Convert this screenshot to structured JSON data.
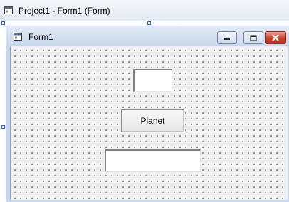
{
  "designer": {
    "title": "Project1 - Form1 (Form)"
  },
  "form": {
    "title": "Form1",
    "controls": {
      "top_textbox_value": "",
      "command_button_label": "Planet",
      "bottom_textbox_value": ""
    }
  },
  "colors": {
    "close_button": "#c7412d",
    "titlebar": "#c7d6ea",
    "form_background": "#f0f0f0"
  },
  "icons": {
    "designer_window": "form-window-icon",
    "form_window": "form-window-icon",
    "minimize": "minimize-icon",
    "maximize": "maximize-icon",
    "close": "close-icon"
  }
}
